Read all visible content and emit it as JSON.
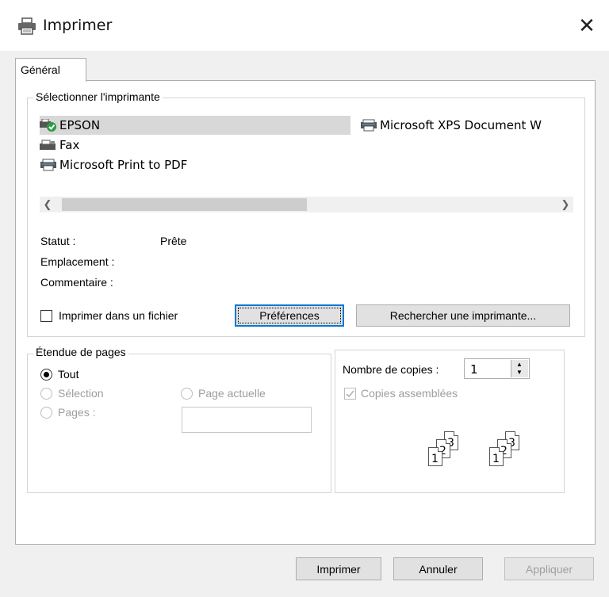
{
  "window": {
    "title": "Imprimer",
    "close_icon": "close-icon",
    "title_icon": "printer-icon"
  },
  "tabs": [
    {
      "label": "Général"
    }
  ],
  "select_printer": {
    "legend": "Sélectionner l'imprimante",
    "printers": [
      {
        "name": "EPSON",
        "icon": "printer-default-icon",
        "selected": true
      },
      {
        "name": "Microsoft XPS Document W",
        "icon": "printer-icon"
      },
      {
        "name": "Fax",
        "icon": "fax-icon"
      },
      {
        "name": "Microsoft Print to PDF",
        "icon": "printer-icon"
      }
    ],
    "status_label": "Statut :",
    "status_value": "Prête",
    "location_label": "Emplacement :",
    "location_value": "",
    "comment_label": "Commentaire :",
    "comment_value": "",
    "print_to_file": {
      "label": "Imprimer dans un fichier",
      "checked": false
    },
    "preferences_button": "Préférences",
    "find_printer_button": "Rechercher une imprimante..."
  },
  "page_range": {
    "legend": "Étendue de pages",
    "all": {
      "label": "Tout",
      "selected": true
    },
    "selection": {
      "label": "Sélection",
      "enabled": false
    },
    "current_page": {
      "label": "Page actuelle",
      "enabled": false
    },
    "pages": {
      "label": "Pages :",
      "enabled": false,
      "value": ""
    }
  },
  "copies": {
    "count_label": "Nombre de copies :",
    "count_value": "1",
    "collate": {
      "label": "Copies assemblées",
      "checked": true,
      "enabled": false
    },
    "collate_pages": [
      "1",
      "2",
      "3"
    ]
  },
  "footer": {
    "print_button": "Imprimer",
    "cancel_button": "Annuler",
    "apply_button": "Appliquer"
  },
  "colors": {
    "accent": "#0078d7",
    "selected_row": "#d8d8d8",
    "client_bg": "#f0f0f0"
  }
}
